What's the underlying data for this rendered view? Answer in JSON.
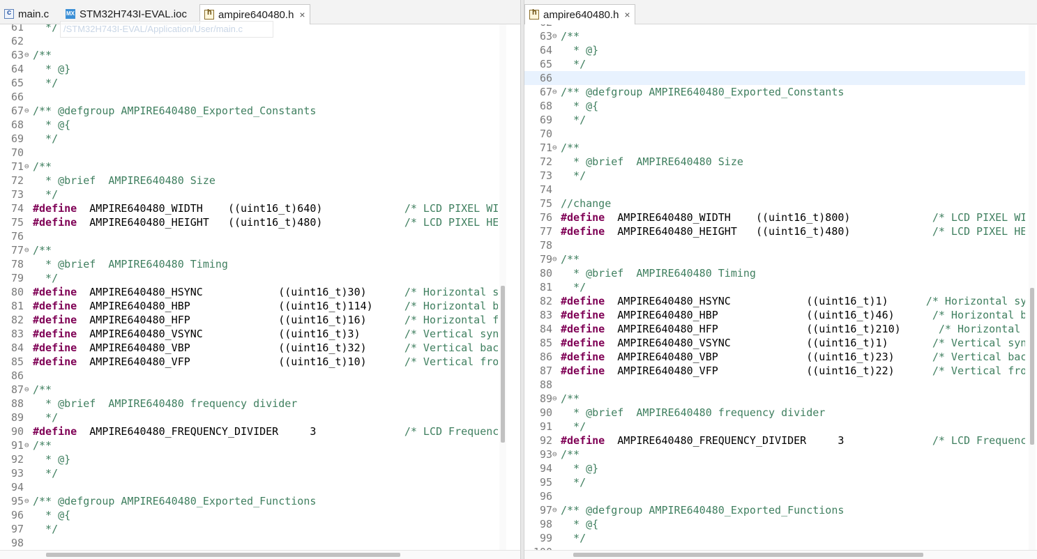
{
  "left_pane": {
    "tabs": [
      {
        "label": "main.c",
        "icon": "c-file-icon",
        "active": false
      },
      {
        "label": "STM32H743I-EVAL.ioc",
        "icon": "mx-file-icon",
        "icon_text": "MX",
        "active": false
      },
      {
        "label": "ampire640480.h",
        "icon": "h-file-icon",
        "active": true,
        "close": "×"
      }
    ],
    "hover_tooltip": "/STM32H743I-EVAL/Application/User/main.c",
    "lines": [
      {
        "n": "61",
        "tokens": [
          {
            "t": "  */",
            "c": "cmt"
          }
        ]
      },
      {
        "n": "62",
        "tokens": []
      },
      {
        "n": "63",
        "fold": "⊖",
        "tokens": [
          {
            "t": "/**",
            "c": "cmt"
          }
        ]
      },
      {
        "n": "64",
        "tokens": [
          {
            "t": "  * @}",
            "c": "cmt"
          }
        ]
      },
      {
        "n": "65",
        "tokens": [
          {
            "t": "  */",
            "c": "cmt"
          }
        ]
      },
      {
        "n": "66",
        "tokens": []
      },
      {
        "n": "67",
        "fold": "⊖",
        "tokens": [
          {
            "t": "/** @defgroup AMPIRE640480_Exported_Constants",
            "c": "cmt"
          }
        ]
      },
      {
        "n": "68",
        "tokens": [
          {
            "t": "  * @{",
            "c": "cmt"
          }
        ]
      },
      {
        "n": "69",
        "tokens": [
          {
            "t": "  */",
            "c": "cmt"
          }
        ]
      },
      {
        "n": "70",
        "tokens": []
      },
      {
        "n": "71",
        "fold": "⊖",
        "tokens": [
          {
            "t": "/**",
            "c": "cmt"
          }
        ]
      },
      {
        "n": "72",
        "tokens": [
          {
            "t": "  * @brief  AMPIRE640480 Size",
            "c": "cmt"
          }
        ]
      },
      {
        "n": "73",
        "tokens": [
          {
            "t": "  */",
            "c": "cmt"
          }
        ]
      },
      {
        "n": "74",
        "tokens": [
          {
            "t": "#define",
            "c": "kw"
          },
          {
            "t": "  AMPIRE640480_WIDTH    ((uint16_t)640)             ",
            "c": ""
          },
          {
            "t": "/* LCD PIXEL WIDTH",
            "c": "cmt"
          }
        ]
      },
      {
        "n": "75",
        "tokens": [
          {
            "t": "#define",
            "c": "kw"
          },
          {
            "t": "  AMPIRE640480_HEIGHT   ((uint16_t)480)             ",
            "c": ""
          },
          {
            "t": "/* LCD PIXEL HEIGHT",
            "c": "cmt"
          }
        ]
      },
      {
        "n": "76",
        "tokens": []
      },
      {
        "n": "77",
        "fold": "⊖",
        "tokens": [
          {
            "t": "/**",
            "c": "cmt"
          }
        ]
      },
      {
        "n": "78",
        "tokens": [
          {
            "t": "  * @brief  AMPIRE640480 Timing",
            "c": "cmt"
          }
        ]
      },
      {
        "n": "79",
        "tokens": [
          {
            "t": "  */",
            "c": "cmt"
          }
        ]
      },
      {
        "n": "80",
        "tokens": [
          {
            "t": "#define",
            "c": "kw"
          },
          {
            "t": "  AMPIRE640480_HSYNC            ((uint16_t)30)      ",
            "c": ""
          },
          {
            "t": "/* Horizontal synchronization",
            "c": "cmt"
          }
        ]
      },
      {
        "n": "81",
        "tokens": [
          {
            "t": "#define",
            "c": "kw"
          },
          {
            "t": "  AMPIRE640480_HBP              ((uint16_t)114)     ",
            "c": ""
          },
          {
            "t": "/* Horizontal back porch",
            "c": "cmt"
          }
        ]
      },
      {
        "n": "82",
        "tokens": [
          {
            "t": "#define",
            "c": "kw"
          },
          {
            "t": "  AMPIRE640480_HFP              ((uint16_t)16)      ",
            "c": ""
          },
          {
            "t": "/* Horizontal front porch",
            "c": "cmt"
          }
        ]
      },
      {
        "n": "83",
        "tokens": [
          {
            "t": "#define",
            "c": "kw"
          },
          {
            "t": "  AMPIRE640480_VSYNC            ((uint16_t)3)       ",
            "c": ""
          },
          {
            "t": "/* Vertical synchronization",
            "c": "cmt"
          }
        ]
      },
      {
        "n": "84",
        "tokens": [
          {
            "t": "#define",
            "c": "kw"
          },
          {
            "t": "  AMPIRE640480_VBP              ((uint16_t)32)      ",
            "c": ""
          },
          {
            "t": "/* Vertical back porch",
            "c": "cmt"
          }
        ]
      },
      {
        "n": "85",
        "tokens": [
          {
            "t": "#define",
            "c": "kw"
          },
          {
            "t": "  AMPIRE640480_VFP              ((uint16_t)10)      ",
            "c": ""
          },
          {
            "t": "/* Vertical front porch",
            "c": "cmt"
          }
        ]
      },
      {
        "n": "86",
        "tokens": []
      },
      {
        "n": "87",
        "fold": "⊖",
        "tokens": [
          {
            "t": "/**",
            "c": "cmt"
          }
        ]
      },
      {
        "n": "88",
        "tokens": [
          {
            "t": "  * @brief  AMPIRE640480 frequency divider",
            "c": "cmt"
          }
        ]
      },
      {
        "n": "89",
        "tokens": [
          {
            "t": "  */",
            "c": "cmt"
          }
        ]
      },
      {
        "n": "90",
        "tokens": [
          {
            "t": "#define",
            "c": "kw"
          },
          {
            "t": "  AMPIRE640480_FREQUENCY_DIVIDER     3              ",
            "c": ""
          },
          {
            "t": "/* LCD Frequency divider",
            "c": "cmt"
          }
        ]
      },
      {
        "n": "91",
        "fold": "⊖",
        "tokens": [
          {
            "t": "/**",
            "c": "cmt"
          }
        ]
      },
      {
        "n": "92",
        "tokens": [
          {
            "t": "  * @}",
            "c": "cmt"
          }
        ]
      },
      {
        "n": "93",
        "tokens": [
          {
            "t": "  */",
            "c": "cmt"
          }
        ]
      },
      {
        "n": "94",
        "tokens": []
      },
      {
        "n": "95",
        "fold": "⊖",
        "tokens": [
          {
            "t": "/** @defgroup AMPIRE640480_Exported_Functions",
            "c": "cmt"
          }
        ]
      },
      {
        "n": "96",
        "tokens": [
          {
            "t": "  * @{",
            "c": "cmt"
          }
        ]
      },
      {
        "n": "97",
        "tokens": [
          {
            "t": "  */",
            "c": "cmt"
          }
        ]
      },
      {
        "n": "98",
        "tokens": []
      }
    ]
  },
  "right_pane": {
    "tabs": [
      {
        "label": "ampire640480.h",
        "icon": "h-file-icon",
        "active": true,
        "close": "×"
      }
    ],
    "lines": [
      {
        "n": "62",
        "tokens": []
      },
      {
        "n": "63",
        "fold": "⊖",
        "tokens": [
          {
            "t": "/**",
            "c": "cmt"
          }
        ]
      },
      {
        "n": "64",
        "tokens": [
          {
            "t": "  * @}",
            "c": "cmt"
          }
        ]
      },
      {
        "n": "65",
        "tokens": [
          {
            "t": "  */",
            "c": "cmt"
          }
        ]
      },
      {
        "n": "66",
        "current": true,
        "tokens": []
      },
      {
        "n": "67",
        "fold": "⊖",
        "tokens": [
          {
            "t": "/** @defgroup AMPIRE640480_Exported_Constants",
            "c": "cmt"
          }
        ]
      },
      {
        "n": "68",
        "tokens": [
          {
            "t": "  * @{",
            "c": "cmt"
          }
        ]
      },
      {
        "n": "69",
        "tokens": [
          {
            "t": "  */",
            "c": "cmt"
          }
        ]
      },
      {
        "n": "70",
        "tokens": []
      },
      {
        "n": "71",
        "fold": "⊖",
        "tokens": [
          {
            "t": "/**",
            "c": "cmt"
          }
        ]
      },
      {
        "n": "72",
        "tokens": [
          {
            "t": "  * @brief  AMPIRE640480 Size",
            "c": "cmt"
          }
        ]
      },
      {
        "n": "73",
        "tokens": [
          {
            "t": "  */",
            "c": "cmt"
          }
        ]
      },
      {
        "n": "74",
        "tokens": []
      },
      {
        "n": "75",
        "tokens": [
          {
            "t": "//change",
            "c": "cmt"
          }
        ]
      },
      {
        "n": "76",
        "tokens": [
          {
            "t": "#define",
            "c": "kw"
          },
          {
            "t": "  AMPIRE640480_WIDTH    ((uint16_t)800)             ",
            "c": ""
          },
          {
            "t": "/* LCD PIXEL WIDTH",
            "c": "cmt"
          }
        ]
      },
      {
        "n": "77",
        "tokens": [
          {
            "t": "#define",
            "c": "kw"
          },
          {
            "t": "  AMPIRE640480_HEIGHT   ((uint16_t)480)             ",
            "c": ""
          },
          {
            "t": "/* LCD PIXEL HEIGHT",
            "c": "cmt"
          }
        ]
      },
      {
        "n": "78",
        "tokens": []
      },
      {
        "n": "79",
        "fold": "⊖",
        "tokens": [
          {
            "t": "/**",
            "c": "cmt"
          }
        ]
      },
      {
        "n": "80",
        "tokens": [
          {
            "t": "  * @brief  AMPIRE640480 Timing",
            "c": "cmt"
          }
        ]
      },
      {
        "n": "81",
        "tokens": [
          {
            "t": "  */",
            "c": "cmt"
          }
        ]
      },
      {
        "n": "82",
        "tokens": [
          {
            "t": "#define",
            "c": "kw"
          },
          {
            "t": "  AMPIRE640480_HSYNC            ((uint16_t)1)      ",
            "c": ""
          },
          {
            "t": "/* Horizontal synchronization",
            "c": "cmt"
          }
        ]
      },
      {
        "n": "83",
        "tokens": [
          {
            "t": "#define",
            "c": "kw"
          },
          {
            "t": "  AMPIRE640480_HBP              ((uint16_t)46)      ",
            "c": ""
          },
          {
            "t": "/* Horizontal back porch",
            "c": "cmt"
          }
        ]
      },
      {
        "n": "84",
        "tokens": [
          {
            "t": "#define",
            "c": "kw"
          },
          {
            "t": "  AMPIRE640480_HFP              ((uint16_t)210)      ",
            "c": ""
          },
          {
            "t": "/* Horizontal front porch",
            "c": "cmt"
          }
        ]
      },
      {
        "n": "85",
        "tokens": [
          {
            "t": "#define",
            "c": "kw"
          },
          {
            "t": "  AMPIRE640480_VSYNC            ((uint16_t)1)       ",
            "c": ""
          },
          {
            "t": "/* Vertical synchronization",
            "c": "cmt"
          }
        ]
      },
      {
        "n": "86",
        "tokens": [
          {
            "t": "#define",
            "c": "kw"
          },
          {
            "t": "  AMPIRE640480_VBP              ((uint16_t)23)      ",
            "c": ""
          },
          {
            "t": "/* Vertical back porch",
            "c": "cmt"
          }
        ]
      },
      {
        "n": "87",
        "tokens": [
          {
            "t": "#define",
            "c": "kw"
          },
          {
            "t": "  AMPIRE640480_VFP              ((uint16_t)22)      ",
            "c": ""
          },
          {
            "t": "/* Vertical front porch",
            "c": "cmt"
          }
        ]
      },
      {
        "n": "88",
        "tokens": []
      },
      {
        "n": "89",
        "fold": "⊖",
        "tokens": [
          {
            "t": "/**",
            "c": "cmt"
          }
        ]
      },
      {
        "n": "90",
        "tokens": [
          {
            "t": "  * @brief  AMPIRE640480 frequency divider",
            "c": "cmt"
          }
        ]
      },
      {
        "n": "91",
        "tokens": [
          {
            "t": "  */",
            "c": "cmt"
          }
        ]
      },
      {
        "n": "92",
        "tokens": [
          {
            "t": "#define",
            "c": "kw"
          },
          {
            "t": "  AMPIRE640480_FREQUENCY_DIVIDER     3              ",
            "c": ""
          },
          {
            "t": "/* LCD Frequency divider",
            "c": "cmt"
          }
        ]
      },
      {
        "n": "93",
        "fold": "⊖",
        "tokens": [
          {
            "t": "/**",
            "c": "cmt"
          }
        ]
      },
      {
        "n": "94",
        "tokens": [
          {
            "t": "  * @}",
            "c": "cmt"
          }
        ]
      },
      {
        "n": "95",
        "tokens": [
          {
            "t": "  */",
            "c": "cmt"
          }
        ]
      },
      {
        "n": "96",
        "tokens": []
      },
      {
        "n": "97",
        "fold": "⊖",
        "tokens": [
          {
            "t": "/** @defgroup AMPIRE640480_Exported_Functions",
            "c": "cmt"
          }
        ]
      },
      {
        "n": "98",
        "tokens": [
          {
            "t": "  * @{",
            "c": "cmt"
          }
        ]
      },
      {
        "n": "99",
        "tokens": [
          {
            "t": "  */",
            "c": "cmt"
          }
        ]
      },
      {
        "n": "100",
        "tokens": []
      }
    ]
  },
  "colors": {
    "comment": "#3f7f5f",
    "keyword": "#7f0055",
    "line_number": "#7a7a7a",
    "current_line": "#e8f2fe",
    "mx_icon": "#3b8fd6"
  }
}
